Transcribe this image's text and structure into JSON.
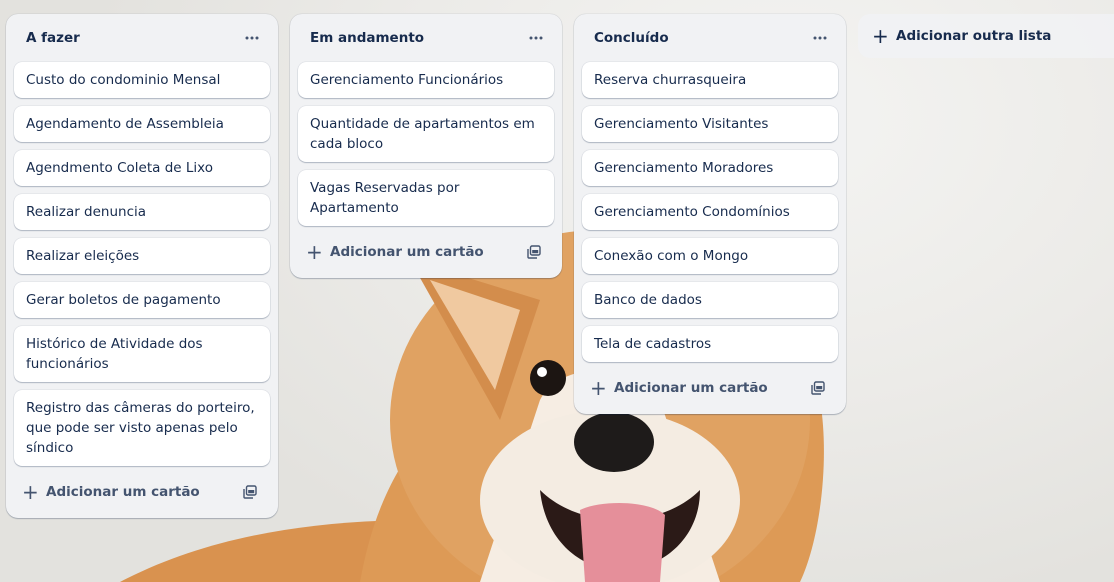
{
  "board": {
    "lists": [
      {
        "title": "A fazer",
        "cards": [
          "Custo do condominio Mensal",
          "Agendamento de Assembleia",
          "Agendmento Coleta de Lixo",
          "Realizar denuncia",
          "Realizar eleições",
          "Gerar boletos de pagamento",
          "Histórico de Atividade dos funcionários",
          "Registro das câmeras do porteiro, que pode ser visto apenas pelo síndico"
        ],
        "add_card_label": "Adicionar um cartão"
      },
      {
        "title": "Em andamento",
        "cards": [
          "Gerenciamento Funcionários",
          "Quantidade de apartamentos em cada bloco",
          "Vagas Reservadas por Apartamento"
        ],
        "add_card_label": "Adicionar um cartão"
      },
      {
        "title": "Concluído",
        "cards": [
          "Reserva churrasqueira",
          "Gerenciamento Visitantes",
          "Gerenciamento Moradores",
          "Gerenciamento Condomínios",
          "Conexão com o Mongo",
          "Banco de dados",
          "Tela de cadastros"
        ],
        "add_card_label": "Adicionar um cartão"
      }
    ],
    "add_list_label": "Adicionar outra lista"
  },
  "icons": {
    "list_menu": "more-horizontal-icon",
    "add": "plus-icon",
    "template": "card-template-icon",
    "background": "corgi-dog-photo"
  },
  "colors": {
    "list_bg": "#f1f2f4",
    "card_bg": "#ffffff",
    "text": "#172b4d",
    "subtle_text": "#44546f"
  }
}
